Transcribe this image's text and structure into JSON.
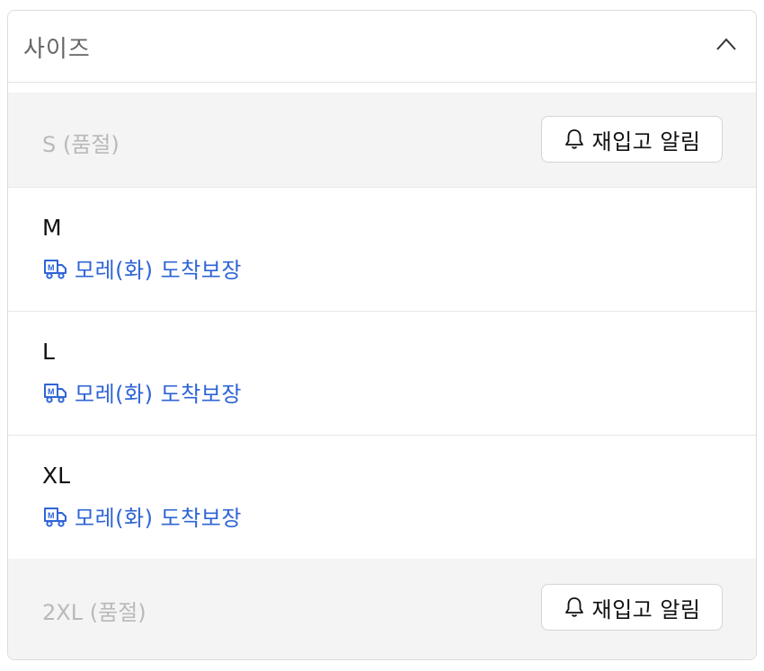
{
  "dropdown": {
    "title": "사이즈",
    "expanded": true
  },
  "options": [
    {
      "size": "S (품절)",
      "status": "soldout",
      "action_label": "재입고 알림"
    },
    {
      "size": "M",
      "status": "instock",
      "delivery": "모레(화) 도착보장"
    },
    {
      "size": "L",
      "status": "instock",
      "delivery": "모레(화) 도착보장"
    },
    {
      "size": "XL",
      "status": "instock",
      "delivery": "모레(화) 도착보장"
    },
    {
      "size": "2XL (품절)",
      "status": "soldout",
      "action_label": "재입고 알림"
    }
  ],
  "colors": {
    "link_blue": "#2f64d6",
    "soldout_bg": "#f4f4f4",
    "soldout_text": "#b9b9b9"
  },
  "icons": [
    "chevron-up-icon",
    "bell-icon",
    "delivery-truck-icon"
  ]
}
